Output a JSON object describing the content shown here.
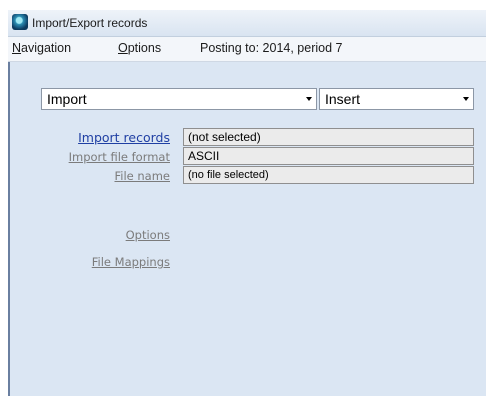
{
  "window": {
    "title": "Import/Export records"
  },
  "menubar": {
    "items": [
      {
        "label": "Navigation"
      },
      {
        "label": "Options"
      }
    ],
    "posting": "Posting to: 2014, period 7"
  },
  "form": {
    "action_select": {
      "value": "Import"
    },
    "mode_select": {
      "value": "Insert"
    },
    "fields": [
      {
        "label": "Import records",
        "value": "(not selected)"
      },
      {
        "label": "Import file format",
        "value": "ASCII"
      },
      {
        "label": "File name",
        "value": "(no file selected)"
      }
    ],
    "links": [
      {
        "label": "Options"
      },
      {
        "label": "File Mappings"
      }
    ]
  }
}
